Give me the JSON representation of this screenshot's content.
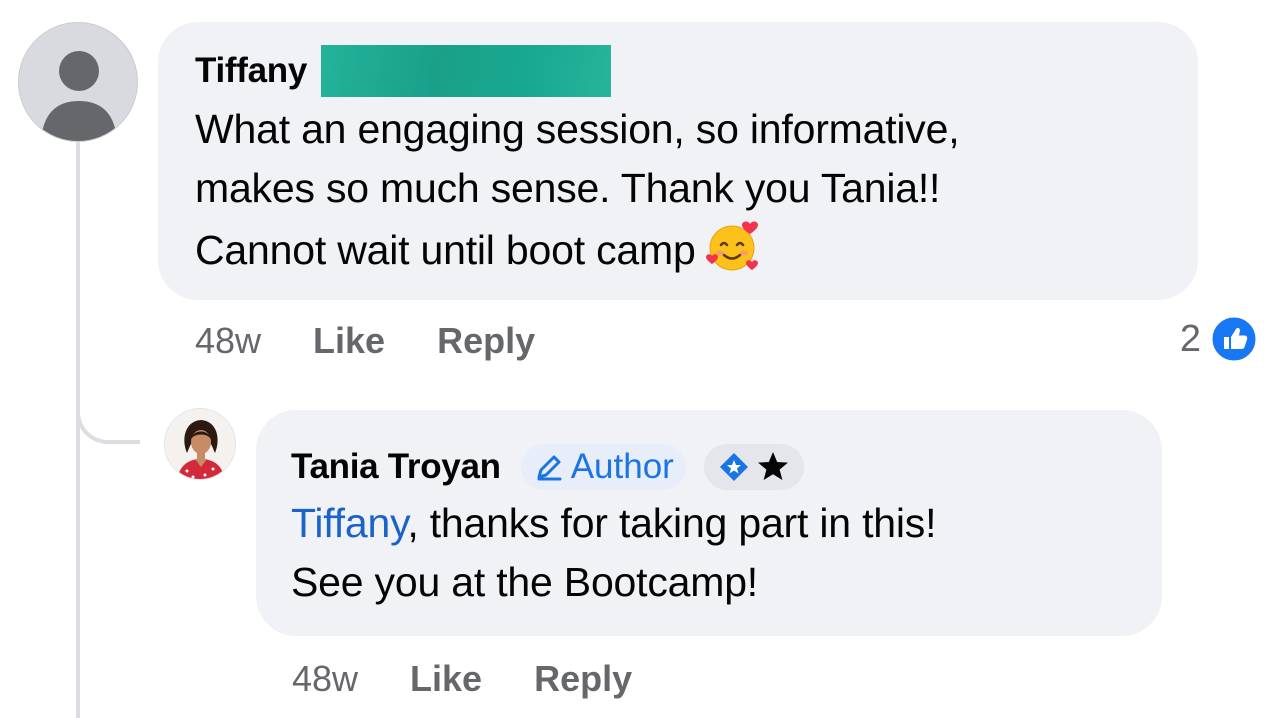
{
  "comments": [
    {
      "author": "Tiffany",
      "text_lines": [
        "What an engaging session, so informative,",
        "makes so much sense. Thank you Tania!!",
        "Cannot wait until boot camp"
      ],
      "emoji": "smiling-face-with-hearts",
      "timestamp": "48w",
      "like_label": "Like",
      "reply_label": "Reply",
      "reaction_count": "2",
      "reaction_icon": "like-thumb-icon"
    },
    {
      "author": "Tania Troyan",
      "author_badge": "Author",
      "mention": "Tiffany",
      "text_line_1_rest": ", thanks for taking part in this!",
      "text_line_2": "See you at the Bootcamp!",
      "timestamp": "48w",
      "like_label": "Like",
      "reply_label": "Reply"
    }
  ],
  "colors": {
    "bubble": "#f0f2f5",
    "link_blue": "#1b63c9",
    "badge_blue": "#1b74e4",
    "muted_text": "#65676b",
    "redaction": "#1aa08a"
  }
}
